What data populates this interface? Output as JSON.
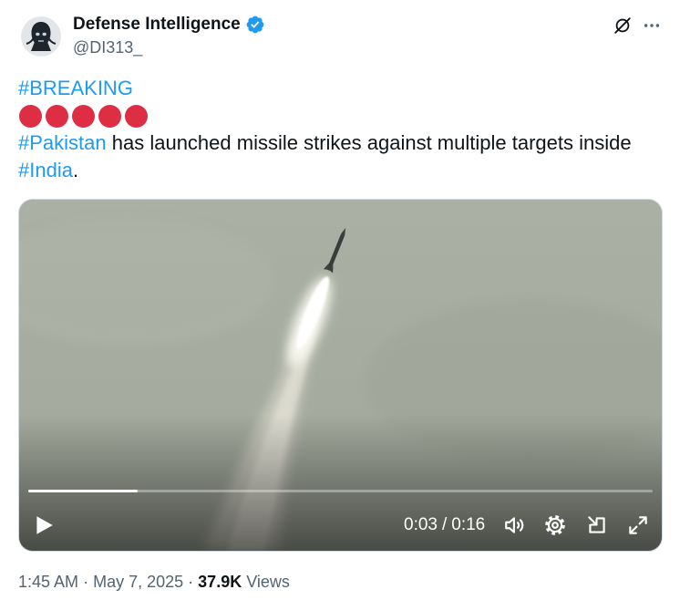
{
  "colors": {
    "accent": "#1d9bf0",
    "text_primary": "#0f1419",
    "text_secondary": "#536471",
    "emoji_red": "#dd2e44",
    "border": "#cfd9de"
  },
  "tweet": {
    "author": {
      "name": "Defense Intelligence",
      "handle": "@DI313_",
      "verified": true,
      "avatar_icon": "defense-intelligence-avatar",
      "verified_icon": "verified-badge-icon"
    },
    "header_actions": {
      "grok_icon": "grok-icon",
      "more_icon": "more-icon"
    },
    "text": {
      "hashtag_breaking": "#BREAKING",
      "emoji_row": {
        "emoji": "red-circle",
        "count": 5
      },
      "hashtag_pakistan": "#Pakistan",
      "sentence": "has launched missile strikes against multiple targets inside",
      "hashtag_india": "#India",
      "trailing": "."
    },
    "media": {
      "current_time": "0:03",
      "time_separator": "/",
      "duration": "0:16",
      "progress": 0.175,
      "controls": {
        "play": "play-icon",
        "volume": "volume-icon",
        "settings": "gear-icon",
        "dock": "pop-out-icon",
        "fullscreen": "expand-icon"
      }
    },
    "meta": {
      "time": "1:45 AM",
      "separator": "·",
      "date": "May 7, 2025",
      "views_count": "37.9K",
      "views_label": "Views"
    }
  }
}
